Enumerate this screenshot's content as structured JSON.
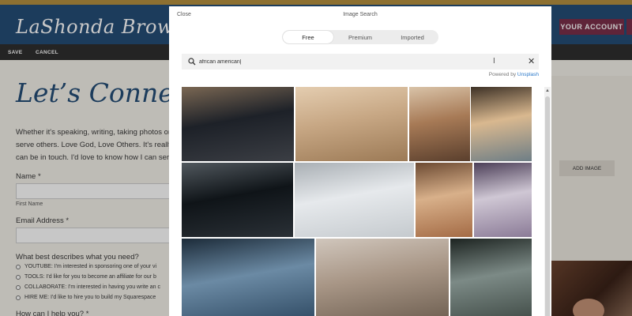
{
  "header": {
    "site_title": "LaShonda Brown",
    "account_button": "YOUR ACCOUNT"
  },
  "edit_bar": {
    "save": "SAVE",
    "cancel": "CANCEL"
  },
  "page": {
    "heading": "Let’s Connect",
    "intro_lines": [
      "Whether it's speaking, writing, taking photos or",
      "serve others. Love God, Love Others. It's really t",
      "can be in touch. I'd love to know how I can ser"
    ],
    "name_label": "Name *",
    "first_name_sub": "First Name",
    "email_label": "Email Address *",
    "describe_label": "What best describes what you need?",
    "options": [
      "YOUTUBE: I'm interested in sponsoring one of your vi",
      "TOOLS: I'd like for you to become an affiliate for our b",
      "COLLABORATE: I'm interested in having you write an c",
      "HIRE ME: I'd like to hire you to build my Squarespace"
    ],
    "help_label": "How can I help you? *",
    "add_image": "ADD IMAGE"
  },
  "modal": {
    "close": "Close",
    "title": "Image Search",
    "tabs": [
      {
        "label": "Free",
        "active": true
      },
      {
        "label": "Premium",
        "active": false
      },
      {
        "label": "Imported",
        "active": false
      }
    ],
    "search_value": "african american|",
    "powered_by": "Powered by",
    "provider": "Unsplash",
    "photos": [
      {
        "name": "dark-dunes",
        "colors": [
          "#1d2128",
          "#3b3e44",
          "#7a6753"
        ]
      },
      {
        "name": "golden-dunes",
        "colors": [
          "#c7a784",
          "#9c7a56",
          "#e4cdb0"
        ]
      },
      {
        "name": "canyon-cliffs",
        "colors": [
          "#a77a56",
          "#5a3f2d",
          "#d9c3a8"
        ]
      },
      {
        "name": "lake-sunset",
        "colors": [
          "#d9b88f",
          "#6e7e86",
          "#3d3126"
        ]
      },
      {
        "name": "moon-lake",
        "colors": [
          "#0f1418",
          "#2a3036",
          "#51585e"
        ]
      },
      {
        "name": "white-architecture",
        "colors": [
          "#e6e9ec",
          "#c5cace",
          "#a9afb4"
        ]
      },
      {
        "name": "desert-rock",
        "colors": [
          "#d8b08a",
          "#a46b45",
          "#6c4a32"
        ]
      },
      {
        "name": "snowy-mountains",
        "colors": [
          "#cfc7d4",
          "#8b7b97",
          "#4c3f58"
        ]
      },
      {
        "name": "blue-mountains",
        "colors": [
          "#6b8aa4",
          "#2f4a63",
          "#1c2b39"
        ]
      },
      {
        "name": "rocky-coast",
        "colors": [
          "#a89686",
          "#6d5e50",
          "#d0c6bc"
        ]
      },
      {
        "name": "misty-forest",
        "colors": [
          "#7c8a86",
          "#3f4a45",
          "#1d2421"
        ]
      }
    ]
  }
}
